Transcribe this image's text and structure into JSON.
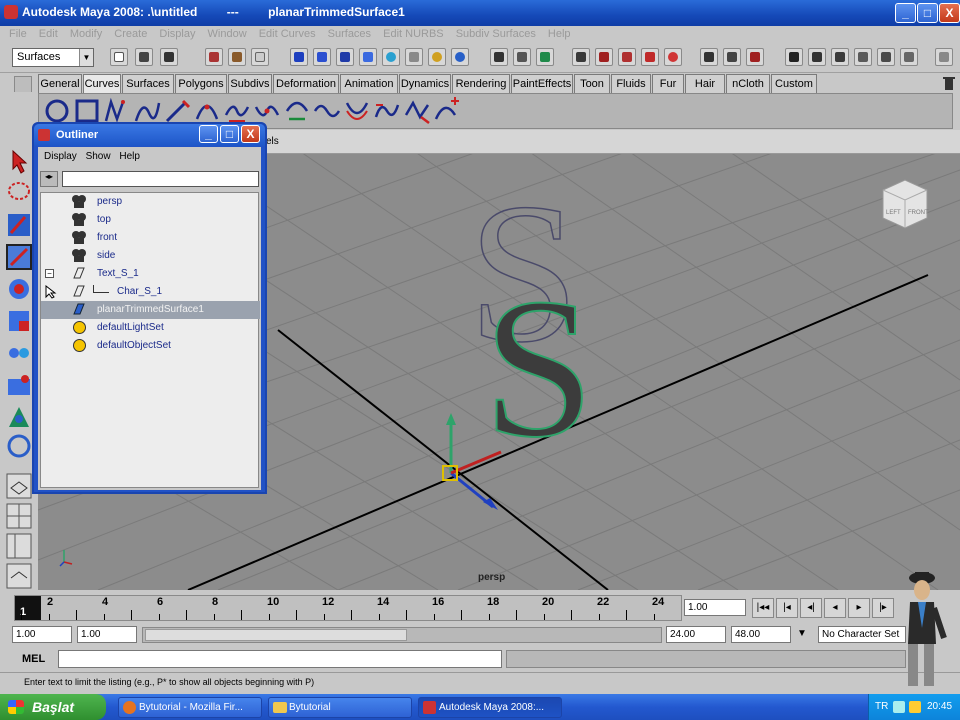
{
  "window": {
    "app_title": "Autodesk Maya 2008: .\\untitled",
    "separator": "---",
    "object_title": "planarTrimmedSurface1",
    "minimize": "_",
    "maximize": "□",
    "close": "X"
  },
  "menubar": [
    "File",
    "Edit",
    "Modify",
    "Create",
    "Display",
    "Window",
    "Edit Curves",
    "Surfaces",
    "Edit NURBS",
    "Subdiv Surfaces",
    "Help"
  ],
  "statusline": {
    "menu_set": "Surfaces"
  },
  "shelf_tabs": [
    "General",
    "Curves",
    "Surfaces",
    "Polygons",
    "Subdivs",
    "Deformation",
    "Animation",
    "Dynamics",
    "Rendering",
    "PaintEffects",
    "Toon",
    "Fluids",
    "Fur",
    "Hair",
    "nCloth",
    "Custom"
  ],
  "shelf_active_tab": "Curves",
  "viewport": {
    "camera_label": "persp",
    "panel_menu_fragment": "els",
    "viewcube_labels": [
      "LEFT",
      "FRONT"
    ]
  },
  "outliner": {
    "title": "Outliner",
    "menus": [
      "Display",
      "Show",
      "Help"
    ],
    "items": [
      {
        "label": "persp",
        "icon": "camera-icon"
      },
      {
        "label": "top",
        "icon": "camera-icon"
      },
      {
        "label": "front",
        "icon": "camera-icon"
      },
      {
        "label": "side",
        "icon": "camera-icon"
      },
      {
        "label": "Text_S_1",
        "icon": "transform-icon"
      },
      {
        "label": "Char_S_1",
        "icon": "transform-icon"
      },
      {
        "label": "planarTrimmedSurface1",
        "icon": "surface-icon",
        "selected": true
      },
      {
        "label": "defaultLightSet",
        "icon": "set-icon"
      },
      {
        "label": "defaultObjectSet",
        "icon": "set-icon"
      }
    ]
  },
  "timeline": {
    "labels": [
      "1",
      "2",
      "4",
      "6",
      "8",
      "10",
      "12",
      "14",
      "16",
      "18",
      "20",
      "22",
      "24"
    ],
    "current_frame": "1.00"
  },
  "range": {
    "start": "1.00",
    "playback_start": "1.00",
    "playback_end": "24.00",
    "end": "48.00",
    "character_set": "No Character Set"
  },
  "command_line": {
    "label": "MEL"
  },
  "help_line": "Enter text to limit the listing (e.g., P* to show all objects beginning with P)",
  "taskbar": {
    "start": "Başlat",
    "buttons": [
      "Bytutorial - Mozilla Fir...",
      "Bytutorial",
      "Autodesk Maya 2008:..."
    ],
    "active_index": 2,
    "lang": "TR",
    "clock": "20:45"
  },
  "colors": {
    "title_blue": "#1549b8",
    "viewport_gray": "#8c8c8c",
    "shelf_gray": "#b4b4b4",
    "selection_green": "#2ea36a",
    "taskbar_blue": "#2358cf",
    "start_green": "#2f8f2f"
  }
}
